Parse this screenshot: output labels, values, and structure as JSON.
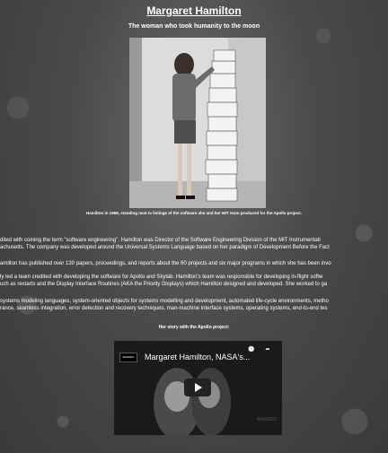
{
  "page": {
    "title": "Margaret Hamilton",
    "subtitle": "The woman who took humanity to the moon",
    "caption": "Hamilton in 1969, standing next to listings of the software she and her MIT team produced for the Apollo project.",
    "paragraphs": [
      "dited with coining the term \"software engineering\". Hamilton was Director of the Software Engineering Division of the MIT Instrumentati",
      "achusetts. The company was developed around the Universal Systems Language based on her paradigm of Development Before the Fact",
      "amilton has published over 130 papers, proceedings, and reports about the 60 projects and six major programs in which she has been invo",
      "ly led a team credited with developing the software for Apollo and Skylab. Hamilton's team was responsible for developing in-flight softw",
      "uch as restarts and the Display Interface Routines (AKA the Priority Displays) which Hamilton designed and developed. She worked to ga",
      "systems modeling languages, system-oriented objects for systems modelling and development, automated life-cycle environments, metho",
      "rance, seamless integration, error detection and recovery techniques, man-machine interface systems, operating systems, end-to-end tes"
    ],
    "story_heading": "Her story with the Apollo project:"
  },
  "video": {
    "channel": "MAKERS",
    "title": "Margaret Hamilton, NASA's...",
    "watermark": "MAKERS"
  }
}
